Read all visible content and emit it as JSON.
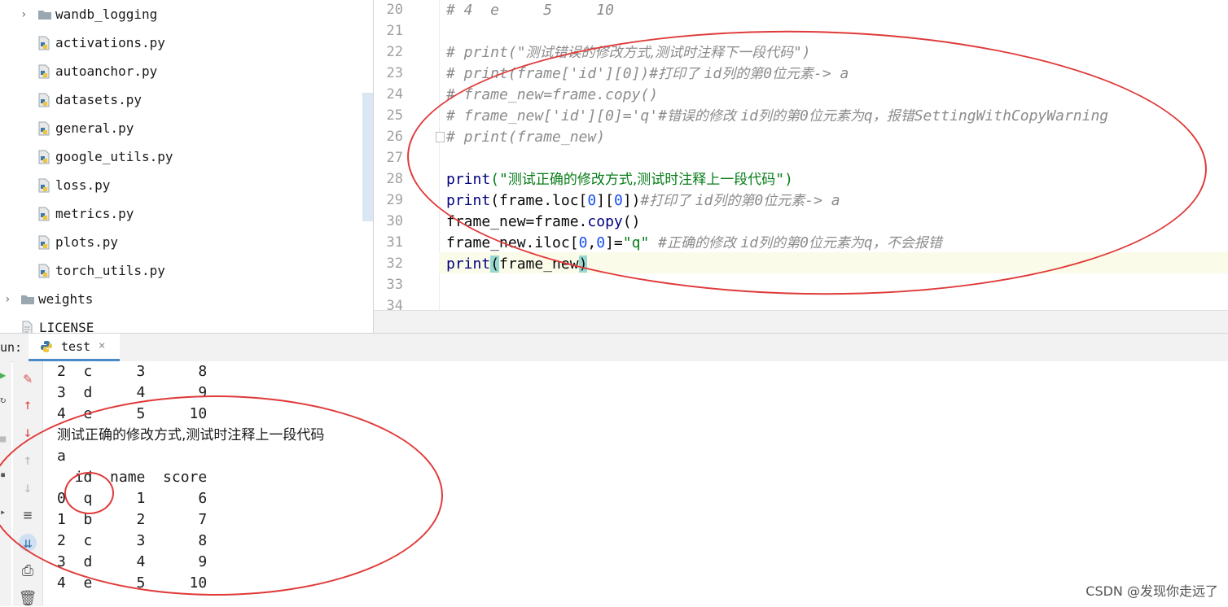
{
  "project_tree": {
    "items": [
      {
        "label": "wandb_logging",
        "type": "folder",
        "collapsed": true
      },
      {
        "label": "activations.py",
        "type": "python-file"
      },
      {
        "label": "autoanchor.py",
        "type": "python-file"
      },
      {
        "label": "datasets.py",
        "type": "python-file"
      },
      {
        "label": "general.py",
        "type": "python-file"
      },
      {
        "label": "google_utils.py",
        "type": "python-file"
      },
      {
        "label": "loss.py",
        "type": "python-file"
      },
      {
        "label": "metrics.py",
        "type": "python-file"
      },
      {
        "label": "plots.py",
        "type": "python-file"
      },
      {
        "label": "torch_utils.py",
        "type": "python-file"
      },
      {
        "label": "weights",
        "type": "folder",
        "collapsed": true
      },
      {
        "label": "LICENSE",
        "type": "text-file"
      }
    ]
  },
  "editor": {
    "line_numbers": [
      "20",
      "21",
      "22",
      "23",
      "24",
      "25",
      "26",
      "27",
      "28",
      "29",
      "30",
      "31",
      "32",
      "33",
      "34"
    ],
    "current_line": "32",
    "code": {
      "l20": "# 4  e     5     10",
      "l22_a": "# print(\"",
      "l22_b": "测试错误的修改方式,测试时注释下一段代码",
      "l22_c": "\")",
      "l23_a": "# print(frame['id'][0])#",
      "l23_b": "打印了 ",
      "l23_c": "id",
      "l23_d": "列的第",
      "l23_e": "0",
      "l23_f": "位元素",
      "l23_g": "-> a",
      "l24": "# frame_new=frame.copy()",
      "l25_a": "# frame_new['id'][0]='q'#",
      "l25_b": "错误的修改 ",
      "l25_c": "id",
      "l25_d": "列的第",
      "l25_e": "0",
      "l25_f": "位元素为",
      "l25_g": "q",
      "l25_h": "，报错",
      "l25_i": "SettingWithCopyWarning",
      "l26": "# print(frame_new)",
      "l28_fn": "print",
      "l28_p1": "(\"",
      "l28_str": "测试正确的修改方式,测试时注释上一段代码",
      "l28_p2": "\")",
      "l29_fn": "print",
      "l29_a": "(frame.loc[",
      "l29_n1": "0",
      "l29_b": "][",
      "l29_n2": "0",
      "l29_c": "])",
      "l29_cm1": "#",
      "l29_cm2": "打印了 ",
      "l29_cm3": "id",
      "l29_cm4": "列的第",
      "l29_cm5": "0",
      "l29_cm6": "位元素",
      "l29_cm7": "-> a",
      "l30_a": "frame_new=frame.",
      "l30_b": "copy",
      "l30_c": "()",
      "l31_a": "frame_new.iloc[",
      "l31_n1": "0",
      "l31_b": ",",
      "l31_n2": "0",
      "l31_c": "]=",
      "l31_str": "\"q\"",
      "l31_cm1": " #",
      "l31_cm2": "正确的修改 ",
      "l31_cm3": "id",
      "l31_cm4": "列的第",
      "l31_cm5": "0",
      "l31_cm6": "位元素为",
      "l31_cm7": "q",
      "l31_cm8": "，不会报错",
      "l32_fn": "print",
      "l32_p1": "(",
      "l32_arg": "frame_new",
      "l32_p2": ")"
    }
  },
  "run_panel": {
    "label": "un:",
    "tab_label": "test",
    "close_glyph": "×"
  },
  "console": {
    "lines": [
      "2  c     3      8",
      "3  d     4      9",
      "4  e     5     10",
      "测试正确的修改方式,测试时注释上一段代码",
      "a",
      "  id  name  score",
      "0  q     1      6",
      "1  b     2      7",
      "2  c     3      8",
      "3  d     4      9",
      "4  e     5     10"
    ]
  },
  "watermark": "CSDN @发现你走远了",
  "colors": {
    "annotation": "#e03a3a",
    "comment": "#8c8c8c",
    "string": "#067d17",
    "number": "#1750eb",
    "keyword": "#000080",
    "tab_underline": "#4a88c7"
  }
}
